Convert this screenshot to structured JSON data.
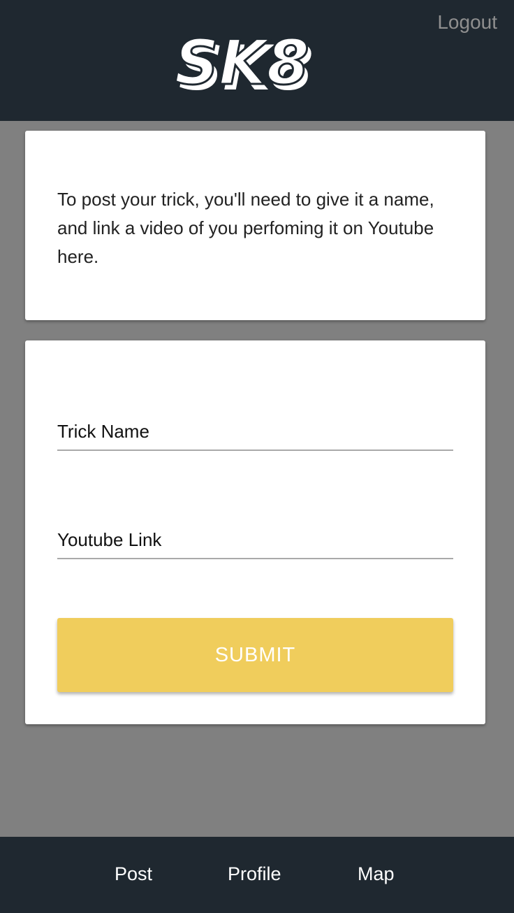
{
  "header": {
    "logout_label": "Logout",
    "logo_text": "SK8"
  },
  "info_card": {
    "text": "To post your trick, you'll need to give it a name, and link a video of you perfoming it on Youtube here."
  },
  "form": {
    "trick_name_placeholder": "Trick Name",
    "trick_name_value": "",
    "youtube_link_placeholder": "Youtube Link",
    "youtube_link_value": "",
    "submit_label": "SUBMIT"
  },
  "footer": {
    "nav": [
      {
        "label": "Post"
      },
      {
        "label": "Profile"
      },
      {
        "label": "Map"
      }
    ]
  },
  "colors": {
    "header_bg": "#1f2830",
    "page_bg": "#808080",
    "accent": "#f0cd5c"
  }
}
